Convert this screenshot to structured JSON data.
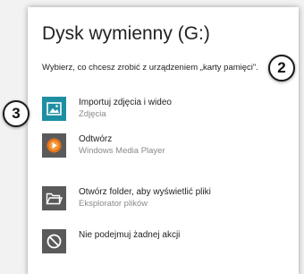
{
  "dialog": {
    "title": "Dysk wymienny (G:)",
    "prompt": "Wybierz, co chcesz zrobić z urządzeniem „karty pamięci\"."
  },
  "options": [
    {
      "primary": "Importuj zdjęcia i wideo",
      "secondary": "Zdjęcia",
      "icon": "photos-icon",
      "color": "#1e8fa3"
    },
    {
      "primary": "Odtwórz",
      "secondary": "Windows Media Player",
      "icon": "media-player-icon",
      "color": "#e5731a"
    },
    {
      "primary": "Otwórz folder, aby wyświetlić pliki",
      "secondary": "Eksplorator plików",
      "icon": "folder-icon",
      "color": "#5a5a5a"
    },
    {
      "primary": "Nie podejmuj żadnej akcji",
      "secondary": "",
      "icon": "no-action-icon",
      "color": "#5a5a5a"
    }
  ],
  "callouts": {
    "first": "2",
    "second": "3"
  }
}
